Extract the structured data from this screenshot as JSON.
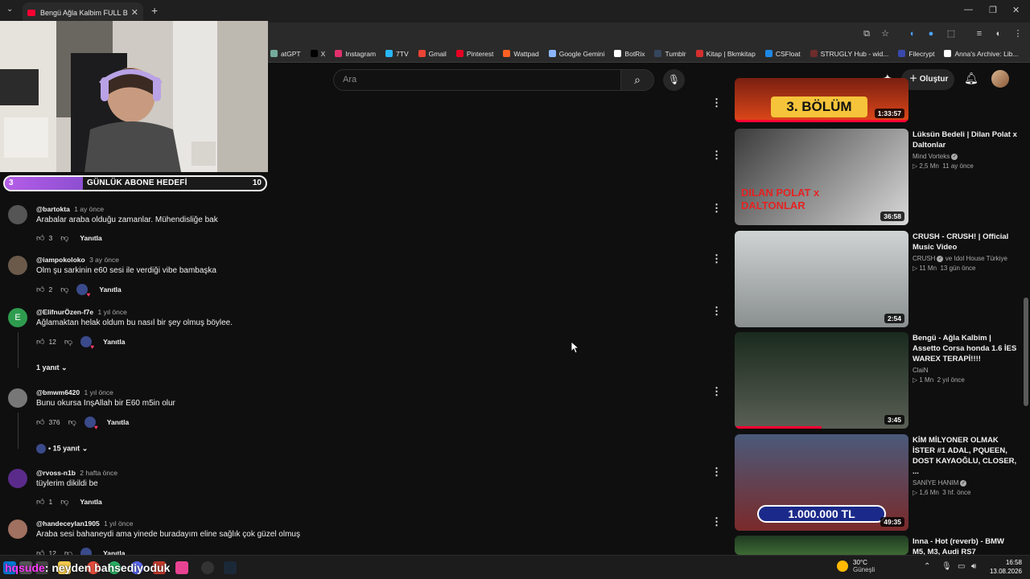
{
  "browser": {
    "tab_title": "Bengü Ağla Kalbim FULL BMW",
    "bookmarks": [
      {
        "label": "atGPT",
        "color": "#74aa9c"
      },
      {
        "label": "X",
        "color": "#000000"
      },
      {
        "label": "Instagram",
        "color": "#e1306c"
      },
      {
        "label": "7TV",
        "color": "#29b6f6"
      },
      {
        "label": "Gmail",
        "color": "#ea4335"
      },
      {
        "label": "Pinterest",
        "color": "#e60023"
      },
      {
        "label": "Wattpad",
        "color": "#ff6122"
      },
      {
        "label": "Google Gemini",
        "color": "#8ab4f8"
      },
      {
        "label": "BotRix",
        "color": "#ffffff"
      },
      {
        "label": "Tumblr",
        "color": "#36465d"
      },
      {
        "label": "Kitap | Bkmkitap",
        "color": "#d32f2f"
      },
      {
        "label": "CSFloat",
        "color": "#1e88e5"
      },
      {
        "label": "STRUGLY Hub - wid...",
        "color": "#6d2c2c"
      },
      {
        "label": "Filecrypt",
        "color": "#3949ab"
      },
      {
        "label": "Anna's Archive: Lib...",
        "color": "#ffffff"
      }
    ]
  },
  "youtube": {
    "search_placeholder": "Ara",
    "create_label": "Oluştur"
  },
  "stream_overlay": {
    "goal_title": "GÜNLÜK ABONE HEDEFİ",
    "goal_current": "3",
    "goal_target": "10",
    "goal_fraction": 0.3,
    "chat_user": "hqsude",
    "chat_message": ": neyden bahsediyoduk"
  },
  "comments": [
    {
      "author": "@bartokta",
      "time": "1 ay önce",
      "text": "Arabalar araba olduğu zamanlar. Mühendisliğe bak",
      "likes": "3",
      "reply": "Yanıtla",
      "avatar_color": "#555555",
      "avatar_letter": "",
      "creator_heart": false
    },
    {
      "author": "@iampokoloko",
      "time": "3 ay önce",
      "text": "Olm şu sarkinin e60 sesi ile verdiği vibe bambaşka",
      "likes": "2",
      "reply": "Yanıtla",
      "avatar_color": "#6b5a4a",
      "avatar_letter": "",
      "creator_heart": true
    },
    {
      "author": "@ElifnurÖzen-f7e",
      "time": "1 yıl önce",
      "text": "Ağlamaktan helak oldum bu nasıl bir şey olmuş böylee.",
      "likes": "12",
      "reply": "Yanıtla",
      "avatar_color": "#2e9c4e",
      "avatar_letter": "E",
      "creator_heart": true,
      "replies": "1 yanıt"
    },
    {
      "author": "@bmwm6420",
      "time": "1 yıl önce",
      "text": "Bunu okursa InşAllah bir E60 m5in olur",
      "likes": "376",
      "reply": "Yanıtla",
      "avatar_color": "#777777",
      "avatar_letter": "",
      "creator_heart": true,
      "replies": "15 yanıt"
    },
    {
      "author": "@rvoss-n1b",
      "time": "2 hafta önce",
      "text": "tüylerim dikildi be",
      "likes": "1",
      "reply": "Yanıtla",
      "avatar_color": "#5a2b8a",
      "avatar_letter": "",
      "creator_heart": false
    },
    {
      "author": "@handeceylan1905",
      "time": "1 yıl önce",
      "text": "Araba sesi bahaneydi ama yinede buradayım eline sağlık çok güzel olmuş",
      "likes": "12",
      "reply": "Yanıtla",
      "avatar_color": "#a07060",
      "avatar_letter": "",
      "creator_heart": true
    }
  ],
  "videos": [
    {
      "thumb_text": "3. BÖLÜM",
      "duration": "1:33:57",
      "title": "",
      "channel": "",
      "meta": ""
    },
    {
      "thumb_text": "DILAN POLAT x DALTONLAR",
      "duration": "36:58",
      "title": "Lüksün Bedeli | Dilan Polat x Daltonlar",
      "channel": "Mind Vorteks",
      "verified": true,
      "views": "2,5 Mn",
      "age": "11 ay önce"
    },
    {
      "thumb_text": "",
      "duration": "2:54",
      "title": "CRUSH - CRUSH! | Official Music Video",
      "channel": "CRUSH",
      "verified": true,
      "channel_extra": "ve Idol House Türkiye",
      "views": "11 Mn",
      "age": "13 gün önce"
    },
    {
      "thumb_text": "",
      "duration": "3:45",
      "title": "Bengü - Ağla Kalbim | Assetto Corsa honda 1.6 İES WAREX TERAPİ!!!!",
      "channel": "ClaiN",
      "verified": false,
      "views": "1 Mn",
      "age": "2 yıl önce",
      "progress": 0.5
    },
    {
      "thumb_text": "1.000.000 TL",
      "duration": "49:35",
      "title": "KİM MİLYONER OLMAK İSTER #1 ADAL, PQUEEN, DOST KAYAOĞLU, CLOSER, ...",
      "channel": "SANİYE HANIM",
      "verified": true,
      "views": "1,6 Mn",
      "age": "3 hf. önce"
    },
    {
      "thumb_text": "",
      "duration": "",
      "title": "Inna - Hot (reverb) - BMW M5, M3, Audi RS7",
      "channel": "",
      "meta": ""
    }
  ],
  "taskbar": {
    "weather_temp": "30°C",
    "weather_desc": "Güneşli",
    "time": "16:58",
    "date": "13.08.2026"
  }
}
